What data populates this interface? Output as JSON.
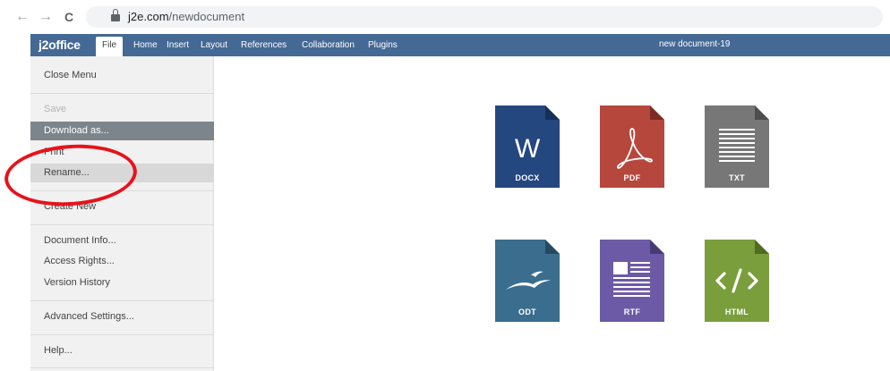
{
  "browser": {
    "back_glyph": "←",
    "forward_glyph": "→",
    "reload_glyph": "C",
    "url_domain": "j2e.com",
    "url_path": "/newdocument"
  },
  "app": {
    "logo": "j2office",
    "menu_tabs": [
      "File",
      "Home",
      "Insert",
      "Layout",
      "References",
      "Collaboration",
      "Plugins"
    ],
    "active_tab": "File",
    "document_title": "new document-19",
    "bar_color": "#446995"
  },
  "file_menu": {
    "items": [
      {
        "label": "Close Menu",
        "state": "normal"
      },
      {
        "label": "Save",
        "state": "disabled"
      },
      {
        "label": "Download as...",
        "state": "selected"
      },
      {
        "label": "Print",
        "state": "normal"
      },
      {
        "label": "Rename...",
        "state": "hover"
      },
      {
        "label": "Create New",
        "state": "normal"
      },
      {
        "label": "Document Info...",
        "state": "normal"
      },
      {
        "label": "Access Rights...",
        "state": "normal"
      },
      {
        "label": "Version History",
        "state": "normal"
      },
      {
        "label": "Advanced Settings...",
        "state": "normal"
      },
      {
        "label": "Help...",
        "state": "normal"
      }
    ]
  },
  "download_formats": [
    {
      "label": "DOCX",
      "icon": "word-icon",
      "color": "#24477f"
    },
    {
      "label": "PDF",
      "icon": "pdf-icon",
      "color": "#b6473c"
    },
    {
      "label": "TXT",
      "icon": "txt-icon",
      "color": "#777777"
    },
    {
      "label": "ODT",
      "icon": "odt-icon",
      "color": "#3a6d8e"
    },
    {
      "label": "RTF",
      "icon": "rtf-icon",
      "color": "#6c5aa6"
    },
    {
      "label": "HTML",
      "icon": "html-icon",
      "color": "#7a9e3b"
    }
  ],
  "annotation_color": "#e8121a"
}
